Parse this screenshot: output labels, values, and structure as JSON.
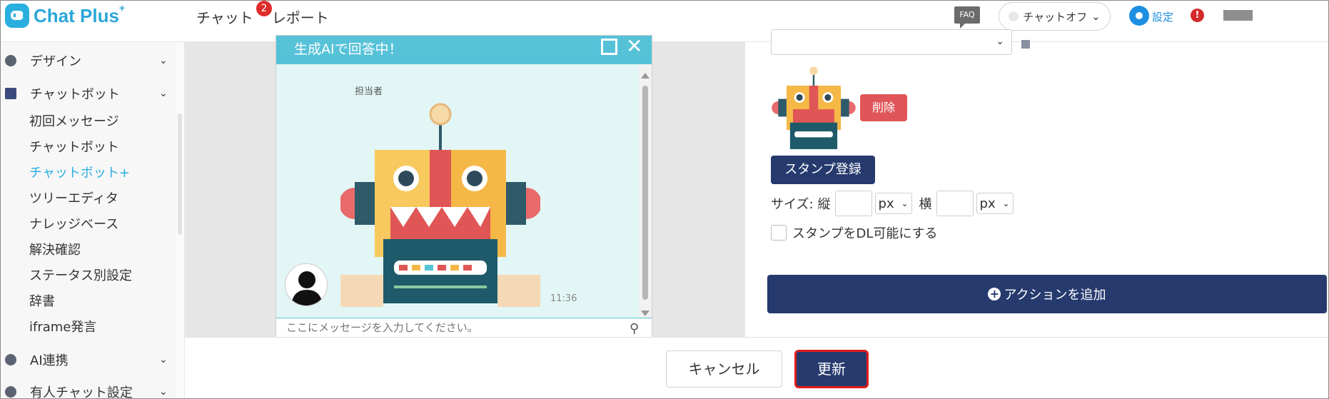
{
  "header": {
    "logo_text": "Chat Plus",
    "logo_sup": "+",
    "nav": [
      {
        "label": "チャット",
        "badge": "2"
      },
      {
        "label": "レポート"
      }
    ],
    "faq": "FAQ",
    "status": "チャットオフ",
    "settings": "設定",
    "alert": "!"
  },
  "sidebar": {
    "design": "デザイン",
    "chatbot": "チャットボット",
    "items": [
      "初回メッセージ",
      "チャットボット",
      "チャットボット+",
      "ツリーエディタ",
      "ナレッジベース",
      "解決確認",
      "ステータス別設定",
      "辞書",
      "iframe発言"
    ],
    "ai": "AI連携",
    "manned": "有人チャット設定"
  },
  "chat": {
    "title": "生成AIで回答中！",
    "agent": "担当者",
    "time": "11:36",
    "placeholder": "ここにメッセージを入力してください。"
  },
  "settings": {
    "delete": "削除",
    "register": "スタンプ登録",
    "size_label": "サイズ:",
    "height_label": "縦",
    "width_label": "横",
    "unit": "px",
    "downloadable": "スタンプをDL可能にする",
    "add_action": "アクションを追加"
  },
  "footer": {
    "cancel": "キャンセル",
    "update": "更新"
  },
  "colors": {
    "brand": "#29aee0",
    "navy": "#263a6e",
    "danger": "#e05559",
    "chat_header": "#56c2d8"
  }
}
